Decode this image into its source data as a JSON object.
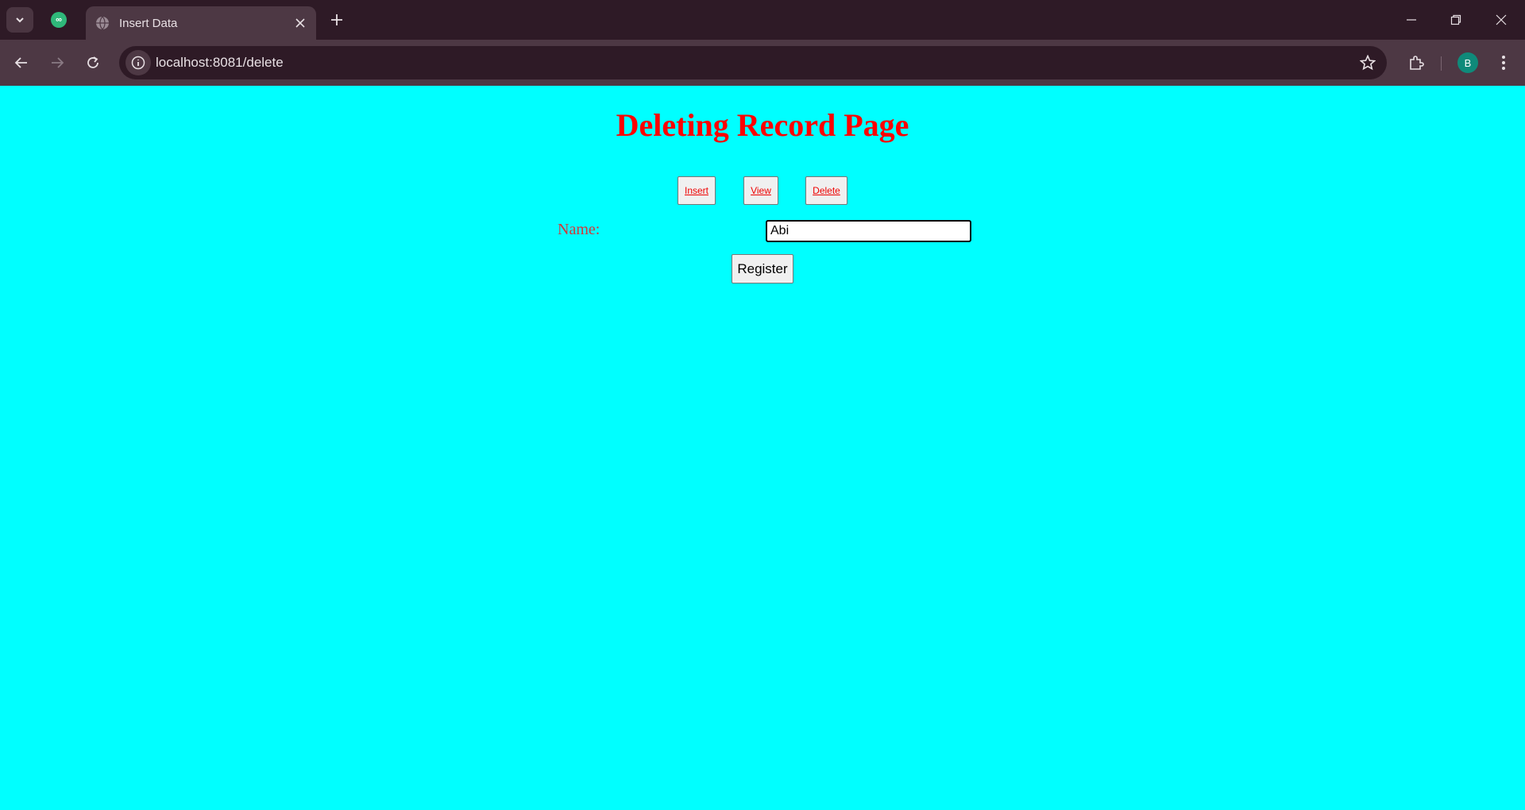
{
  "browser": {
    "tab_title": "Insert Data",
    "url": "localhost:8081/delete",
    "profile_initial": "B",
    "icons": {
      "tab_search": "chevron-down-icon",
      "pinned": "pinned-app-icon",
      "favicon": "globe-icon",
      "close": "close-icon",
      "new_tab": "plus-icon",
      "back": "arrow-left-icon",
      "forward": "arrow-right-icon",
      "reload": "reload-icon",
      "site_info": "info-icon",
      "bookmark": "star-icon",
      "extensions": "puzzle-icon",
      "menu": "kebab-menu-icon"
    }
  },
  "page": {
    "title": "Deleting Record Page",
    "nav": {
      "insert": "Insert",
      "view": "View",
      "delete": "Delete"
    },
    "form": {
      "name_label": "Name:",
      "name_value": "Abi",
      "submit_label": "Register"
    },
    "colors": {
      "background": "#00ffff",
      "title": "#ff0000",
      "label": "#d2383a",
      "link": "#ee0000"
    }
  }
}
